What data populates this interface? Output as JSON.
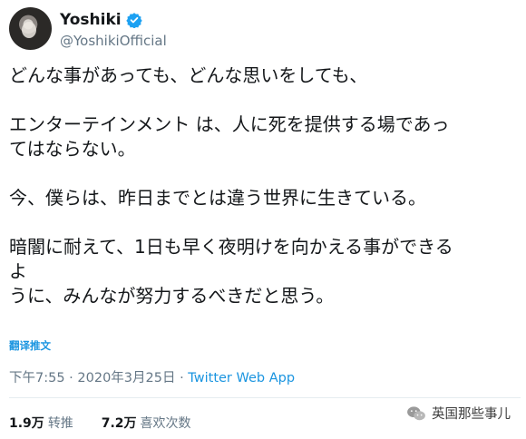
{
  "author": {
    "display_name": "Yoshiki",
    "handle": "@YoshikiOfficial",
    "verified": true
  },
  "tweet": {
    "lines": [
      "どんな事があっても、どんな思いをしても、",
      "",
      "エンターテインメント は、人に死を提供する場であっ",
      "てはならない。",
      "",
      "今、僕らは、昨日までとは違う世界に生きている。",
      "",
      "暗闇に耐えて、1日も早く夜明けを向かえる事ができる",
      "よ",
      "うに、みんなが努力するべきだと思う。"
    ]
  },
  "translate_label": "翻译推文",
  "meta": {
    "time": "下午7:55",
    "date": "2020年3月25日",
    "separator": "·",
    "app": "Twitter Web App"
  },
  "stats": {
    "retweets_count": "1.9万",
    "retweets_label": "转推",
    "likes_count": "7.2万",
    "likes_label": "喜欢次数"
  },
  "watermark": {
    "text": "英国那些事儿",
    "icon": "wechat-icon"
  },
  "colors": {
    "text": "#14171a",
    "secondary": "#657786",
    "link": "#1b95e0",
    "verified": "#1da1f2"
  }
}
